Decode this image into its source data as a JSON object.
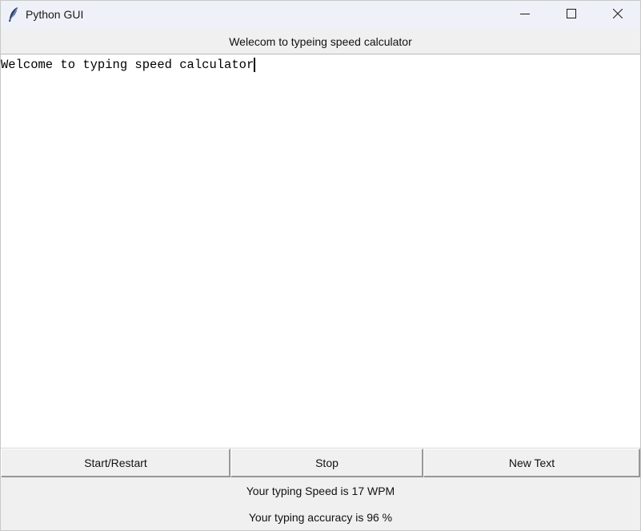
{
  "window": {
    "title": "Python GUI",
    "icon": "feather-icon"
  },
  "header": {
    "label": "Welecom to typeing speed calculator"
  },
  "editor": {
    "text": "Welcome to typing speed calculator"
  },
  "buttons": {
    "start_label": "Start/Restart",
    "stop_label": "Stop",
    "new_text_label": "New Text"
  },
  "status": {
    "speed_text": "Your typing Speed is 17 WPM",
    "accuracy_text": "Your typing accuracy is 96 %"
  }
}
